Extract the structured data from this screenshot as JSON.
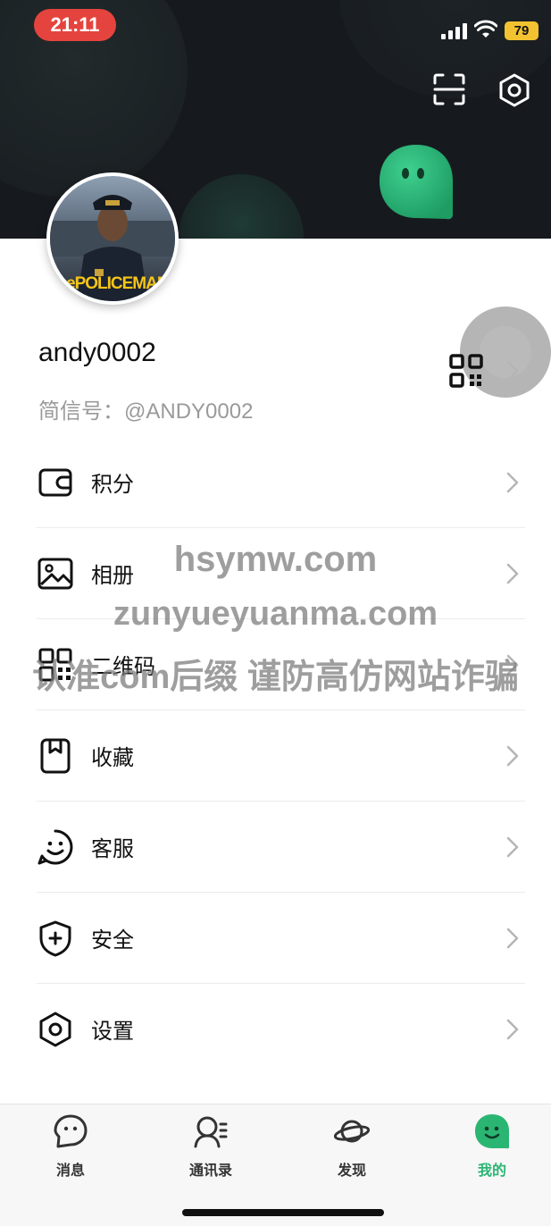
{
  "status_bar": {
    "time": "21:11",
    "battery": "79"
  },
  "header": {
    "avatar_caption": "LePOLICEMAN"
  },
  "profile": {
    "username": "andy0002",
    "handle": "简信号：@ANDY0002"
  },
  "menu": {
    "items": [
      {
        "label": "积分",
        "icon": "wallet-icon"
      },
      {
        "label": "相册",
        "icon": "image-icon"
      },
      {
        "label": "二维码",
        "icon": "qr-code-icon"
      },
      {
        "label": "收藏",
        "icon": "bookmark-icon"
      },
      {
        "label": "客服",
        "icon": "support-smile-icon"
      },
      {
        "label": "安全",
        "icon": "shield-plus-icon"
      },
      {
        "label": "设置",
        "icon": "hexagon-settings-icon"
      }
    ]
  },
  "watermark": {
    "line1": "hsymw.com",
    "line2": "zunyueyuanma.com",
    "line3": "认准com后缀 谨防高仿网站诈骗"
  },
  "tabs": [
    {
      "label": "消息",
      "icon": "message-bubble-icon"
    },
    {
      "label": "通讯录",
      "icon": "contacts-icon"
    },
    {
      "label": "发现",
      "icon": "planet-icon"
    },
    {
      "label": "我的",
      "icon": "mascot-icon",
      "active": true
    }
  ],
  "colors": {
    "accent": "#2bb573",
    "header_bg": "#161a1f",
    "time_pill": "#e5443e"
  }
}
